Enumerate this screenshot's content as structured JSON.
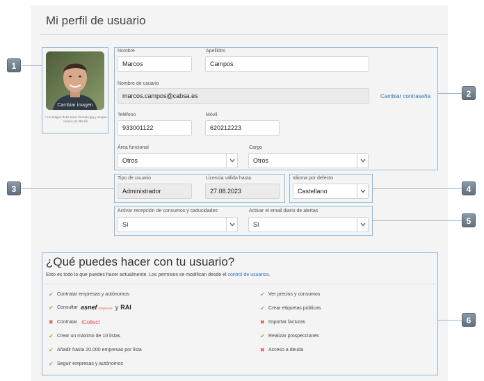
{
  "page": {
    "title": "Mi perfil de usuario"
  },
  "callouts": [
    "1",
    "2",
    "3",
    "4",
    "5",
    "6"
  ],
  "avatar": {
    "caption": "Cambiar imagen",
    "note": "* La imagen debe tener formato jpg y ocupar menos de 300 Kb"
  },
  "form": {
    "nombre": {
      "label": "Nombre",
      "value": "Marcos"
    },
    "apellidos": {
      "label": "Apellidos",
      "value": "Campos"
    },
    "usuario": {
      "label": "Nombre de usuario",
      "value": "marcos.campos@cabsa.es"
    },
    "change_password": "Cambiar contraseña",
    "telefono": {
      "label": "Teléfono",
      "value": "933001122"
    },
    "movil": {
      "label": "Móvil",
      "value": "620212223"
    },
    "area": {
      "label": "Área funcional",
      "value": "Otros"
    },
    "cargo": {
      "label": "Cargo",
      "value": "Otros"
    },
    "tipo": {
      "label": "Tipo de usuario",
      "value": "Administrador"
    },
    "licencia": {
      "label": "Licencia válida hasta",
      "value": "27.08.2023"
    },
    "idioma": {
      "label": "Idioma por defecto",
      "value": "Castellano"
    },
    "consumos": {
      "label": "Activar recepción de consumos y caducidades",
      "value": "Sí"
    },
    "alertas": {
      "label": "Activar el email diario de alertas",
      "value": "Sí"
    }
  },
  "permissions": {
    "title": "¿Qué puedes hacer con tu usuario?",
    "desc": "Esto es todo lo que puedes hacer actualmente. Los permisos se modifican desde el",
    "desc_link": "control de usuarios",
    "desc_end": ".",
    "left": [
      {
        "text": "Contratar empresas y autónomos",
        "allowed": true
      },
      {
        "text": "Consultar",
        "brand": "asnef",
        "brand_sub": "Empresas",
        "brand_and": "y",
        "brand2": "RAI",
        "allowed": true
      },
      {
        "text": "Contratar",
        "brand": "iCollect",
        "allowed": false
      },
      {
        "text": "Crear un máximo de 10 listas",
        "allowed": true
      },
      {
        "text": "Añadir hasta 20.000 empresas por lista",
        "allowed": true
      },
      {
        "text": "Seguir empresas y autónomos",
        "allowed": true
      }
    ],
    "right": [
      {
        "text": "Ver precios y consumos",
        "allowed": true
      },
      {
        "text": "Crear etiquetas públicas",
        "allowed": true
      },
      {
        "text": "Importar facturas",
        "allowed": false
      },
      {
        "text": "Realizar prospecciones",
        "allowed": true
      },
      {
        "text": "Acceso a deuda",
        "allowed": false
      }
    ],
    "marks": {
      "ok": "✔",
      "no": "✖"
    }
  },
  "colors": {
    "accent": "#2a72b8",
    "callout_border": "#8db8d8",
    "ok": "#7cb342",
    "no": "#d9534f"
  }
}
